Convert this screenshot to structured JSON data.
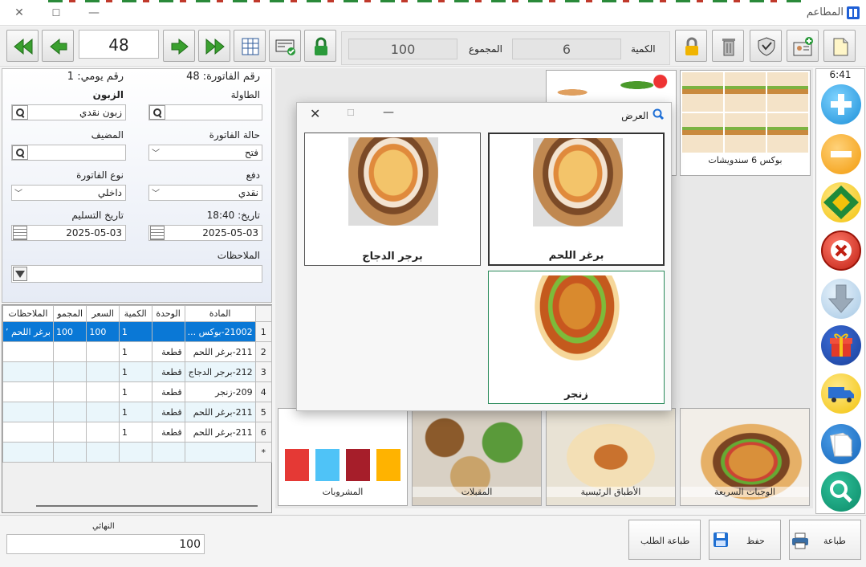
{
  "window": {
    "title": "المطاعم",
    "close": "✕",
    "maximize": "☐",
    "minimize": "—"
  },
  "toolbar": {
    "invoice_number": "48",
    "total_label": "المجموع",
    "total_value": "100",
    "qty_label": "الكمية",
    "qty_value": "6"
  },
  "clock": "6:41",
  "form": {
    "invoice_no": "رقم الفاتورة: 48",
    "daily_no": "رقم يومي: 1",
    "table_label": "الطاولة",
    "customer_label": "الزبون",
    "customer_value": "زبون نقدي",
    "status_label": "حالة الفاتورة",
    "status_value": "فتح",
    "host_label": "المضيف",
    "payment_label": "دفع",
    "payment_value": "نقدي",
    "type_label": "نوع الفاتورة",
    "type_value": "داخلي",
    "date_label": "تاريخ: 18:40",
    "date_value": "2025-05-03",
    "delivery_label": "تاريخ التسليم",
    "delivery_value": "2025-05-03",
    "notes_label": "الملاحظات"
  },
  "grid": {
    "headers": [
      "المادة",
      "الوحدة",
      "الكمية",
      "السعر",
      "المجمو",
      "الملاحظات"
    ],
    "rows": [
      {
        "n": "1",
        "item": "21002-بوكس ...",
        "unit": "",
        "qty": "1",
        "price": "100",
        "total": "100",
        "notes": "برغر اللحم ٬"
      },
      {
        "n": "2",
        "item": "211-برغر اللحم",
        "unit": "قطعة",
        "qty": "1",
        "price": "",
        "total": "",
        "notes": ""
      },
      {
        "n": "3",
        "item": "212-برجر الدجاج",
        "unit": "قطعة",
        "qty": "1",
        "price": "",
        "total": "",
        "notes": ""
      },
      {
        "n": "4",
        "item": "209-زنجر",
        "unit": "قطعة",
        "qty": "1",
        "price": "",
        "total": "",
        "notes": ""
      },
      {
        "n": "5",
        "item": "211-برغر اللحم",
        "unit": "قطعة",
        "qty": "1",
        "price": "",
        "total": "",
        "notes": ""
      },
      {
        "n": "6",
        "item": "211-برغر اللحم",
        "unit": "قطعة",
        "qty": "1",
        "price": "",
        "total": "",
        "notes": ""
      }
    ]
  },
  "products": {
    "box_label": "بوكس 6 سندويشات"
  },
  "categories": [
    "الوجبات السريعة",
    "الأطباق الرئيسية",
    "المقبلات",
    "المشروبات"
  ],
  "modal": {
    "title": "العرض",
    "items": [
      "برغر اللحم",
      "برجر الدجاج",
      "زنجر"
    ]
  },
  "bottom": {
    "final_label": "النهائي",
    "final_value": "100",
    "print_label": "طباعة",
    "save_label": "حفظ",
    "print_order_label": "طباعة الطلب"
  }
}
